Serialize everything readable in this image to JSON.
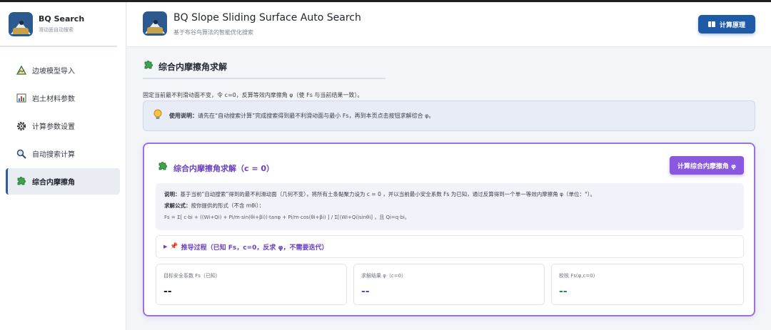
{
  "sidebar": {
    "title": "BQ Search",
    "subtitle": "滑动面自动搜索",
    "items": [
      {
        "label": "边坡模型导入",
        "icon": "triangle-icon"
      },
      {
        "label": "岩土材料参数",
        "icon": "bar-chart-icon"
      },
      {
        "label": "计算参数设置",
        "icon": "gear-icon"
      },
      {
        "label": "自动搜索计算",
        "icon": "search-icon"
      },
      {
        "label": "综合内摩擦角",
        "icon": "puzzle-icon",
        "active": true
      }
    ]
  },
  "header": {
    "title": "BQ Slope Sliding Surface Auto Search",
    "subtitle": "基于布谷鸟算法的智能优化搜索",
    "button": "计算原理"
  },
  "section": {
    "title": "综合内摩擦角求解",
    "description": "固定当前最不利滑动面不变，令 c=0，反算等效内摩擦角 φ（使 Fs 与当前结果一致）。",
    "tip_label": "使用说明：",
    "tip_text": "请先在“自动搜索计算”完成搜索得到最不利滑动面与最小 Fs，再到本页点击按钮求解综合 φ。"
  },
  "card": {
    "title": "综合内摩擦角求解（c = 0）",
    "button": "计算综合内摩擦角 φ",
    "info_label1": "说明：",
    "info_text1": "基于当前“自动搜索”得到的最不利滑动面（几何不变），将所有土条黏聚力设为 c = 0 ，并以当前最小安全系数 Fs 为已知，通过反算得到一个单一等效内摩擦角 φ（单位：°）。",
    "info_label2": "求解公式：",
    "info_text2": "按你提供的形式（不含 mθi）：",
    "formula": "Fs = Σ[ c·bi + ((Wi+Qi) + Pi/m·sin(θi+βi))·tanφ + Pi/m·cos(θi+βi) ] / Σ[(Wi+Qi)sinθi] ，且 Qi=q·bi。",
    "derivation": "推导过程（已知 Fs，c=0，反求 φ，不需要迭代）",
    "metrics": [
      {
        "label": "目标安全系数 Fs（已知）",
        "value": "--",
        "color": "#23272f"
      },
      {
        "label": "求解结果 φ（c=0）",
        "value": "--",
        "color": "#6a3fbf"
      },
      {
        "label": "校核 Fs(φ,c=0)",
        "value": "--",
        "color": "#2a8a4a"
      }
    ]
  }
}
